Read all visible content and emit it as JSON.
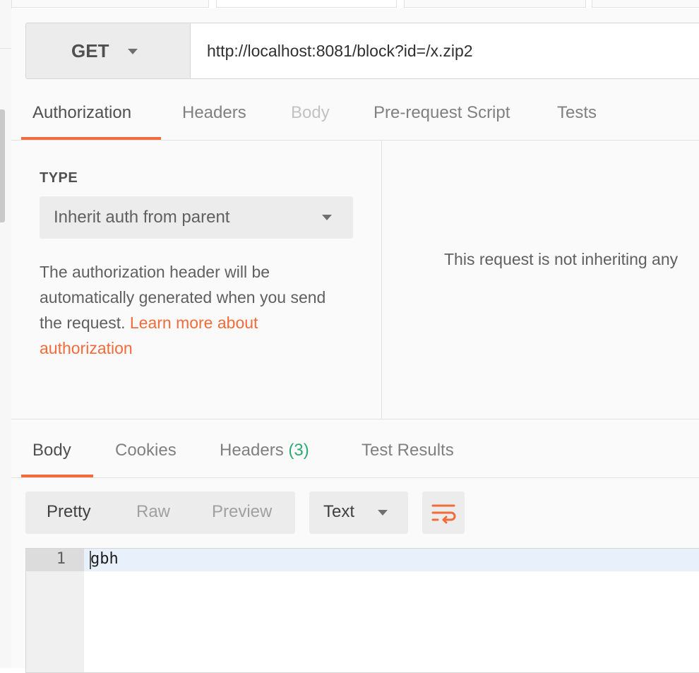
{
  "request": {
    "method": "GET",
    "url": "http://localhost:8081/block?id=/x.zip2"
  },
  "request_tabs": [
    {
      "label": "Authorization",
      "state": "active"
    },
    {
      "label": "Headers",
      "state": "normal"
    },
    {
      "label": "Body",
      "state": "disabled"
    },
    {
      "label": "Pre-request Script",
      "state": "normal"
    },
    {
      "label": "Tests",
      "state": "normal"
    }
  ],
  "auth": {
    "type_label": "TYPE",
    "type_value": "Inherit auth from parent",
    "description": "The authorization header will be automatically generated when you send the request. ",
    "learn_more_link": "Learn more about authorization",
    "inherit_message": "This request is not inheriting any"
  },
  "response_tabs": [
    {
      "label": "Body",
      "state": "active"
    },
    {
      "label": "Cookies",
      "state": "normal"
    },
    {
      "label": "Headers",
      "count": "(3)",
      "state": "normal"
    },
    {
      "label": "Test Results",
      "state": "normal"
    }
  ],
  "response_view": {
    "modes": [
      "Pretty",
      "Raw",
      "Preview"
    ],
    "active_mode": "Pretty",
    "format": "Text"
  },
  "editor": {
    "line_number": "1",
    "content": "gbh"
  },
  "colors": {
    "accent": "#f26b3a",
    "count_green": "#2eaa73"
  },
  "icons": {
    "wrap": "wrap-lines-icon",
    "dropdown": "chevron-down-icon"
  }
}
